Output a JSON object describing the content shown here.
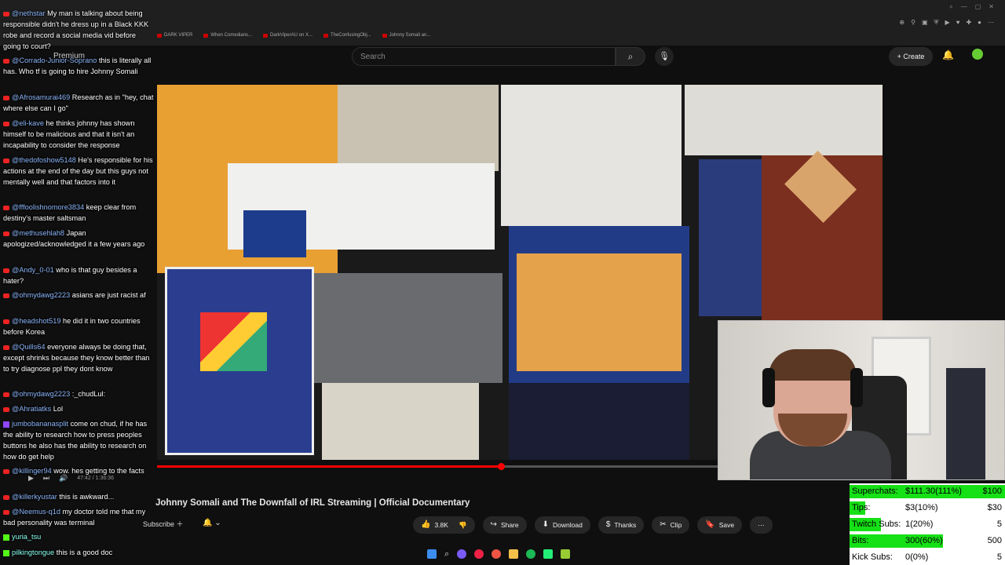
{
  "browser": {
    "bookmarks": [
      "DARK VIPER",
      "When Comedians...",
      "DarkViperAU on X...",
      "TheConfusingObj...",
      "Johnny Somali an..."
    ]
  },
  "youtube": {
    "search_placeholder": "Search",
    "create_label": "Create",
    "premium_label": "Premium"
  },
  "video": {
    "title": "Johnny Somali and The Downfall of IRL Streaming | Official Documentary",
    "time": "47:42 / 1:36:36",
    "progress_fraction": 0.405,
    "subscribe_label": "Subscribe",
    "actions": {
      "like_count": "3.8K",
      "share": "Share",
      "download": "Download",
      "thanks": "Thanks",
      "clip": "Clip",
      "save": "Save"
    }
  },
  "chat": [
    {
      "platform": "youtube",
      "user": "@nethstar",
      "text": "My man is talking about being responsible didn't he dress up in a Black KKK robe and record a social media vid before going to court?"
    },
    {
      "platform": "youtube",
      "user": "@Corrado-Junior-Soprano",
      "text": "this is literally all has. Who tf is going to hire Johnny Somali"
    },
    {
      "platform": "youtube",
      "user": "@Afrosamurai469",
      "text": "Research as in \"hey, chat where else can I go\""
    },
    {
      "platform": "youtube",
      "user": "@eli-kave",
      "text": "he thinks johnny has shown himself to be malicious and that it isn't an incapability to consider the response"
    },
    {
      "platform": "youtube",
      "user": "@thedofoshow5148",
      "text": "He's responsible for his actions at the end of the day but this guys not mentally well and that factors into it"
    },
    {
      "platform": "youtube",
      "user": "@fffoolishnomore3834",
      "text": "keep clear from destiny's master saltsman"
    },
    {
      "platform": "youtube",
      "user": "@methusehlah8",
      "text": "Japan apologized/acknowledged it a few years ago"
    },
    {
      "platform": "youtube",
      "user": "@Andy_0-01",
      "text": "who is that guy besides a hater?"
    },
    {
      "platform": "youtube",
      "user": "@ohmydawg2223",
      "text": "asians are just racist af"
    },
    {
      "platform": "youtube",
      "user": "@headshot519",
      "text": "he did it in two countries before Korea"
    },
    {
      "platform": "youtube",
      "user": "@Quills64",
      "text": "everyone always be doing that, except shrinks because they know better than to try diagnose ppl they dont know"
    },
    {
      "platform": "youtube",
      "user": "@ohmydawg2223",
      "text": ":_chudLul:"
    },
    {
      "platform": "youtube",
      "user": "@Ahratiatks",
      "text": "Lol"
    },
    {
      "platform": "twitch",
      "user": "jumbobananasplit",
      "text": "come on chud, if he has the ability to research how to press peoples buttons he also has the ability to research on how do get help"
    },
    {
      "platform": "youtube",
      "user": "@killinger94",
      "text": "wow. hes getting to the facts"
    },
    {
      "platform": "youtube",
      "user": "@killerkyustar",
      "text": "this is awkward..."
    },
    {
      "platform": "youtube",
      "user": "@Neemus-q1d",
      "text": "my doctor told me that my bad personality was terminal"
    },
    {
      "platform": "kick",
      "user": "yuria_tsu",
      "text": ""
    },
    {
      "platform": "kick",
      "user": "pilkingtongue",
      "text": "this is a good doc"
    }
  ],
  "donations": [
    {
      "label": "Superchats:",
      "value": "$111.30(111%)",
      "goal": "$100",
      "fraction": 1.0
    },
    {
      "label": "Tips:",
      "value": "$3(10%)",
      "goal": "$30",
      "fraction": 0.1
    },
    {
      "label": "Twitch Subs:",
      "value": "1(20%)",
      "goal": "5",
      "fraction": 0.2
    },
    {
      "label": "Bits:",
      "value": "300(60%)",
      "goal": "500",
      "fraction": 0.6
    },
    {
      "label": "Kick Subs:",
      "value": "0(0%)",
      "goal": "5",
      "fraction": 0.0
    }
  ],
  "colors": {
    "progress": "#ff0000",
    "goal_bar": "#16e016",
    "youtube_badge": "#e22222",
    "kick_badge": "#53fc18",
    "twitch_badge": "#9146ff"
  }
}
